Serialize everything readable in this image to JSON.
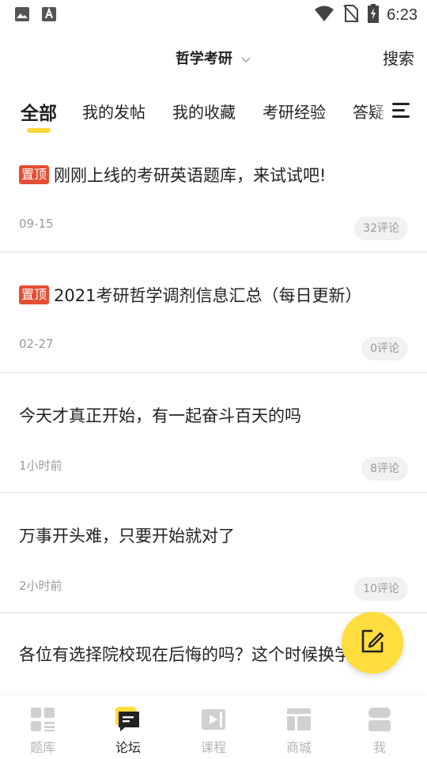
{
  "status_bar": {
    "time": "6:23",
    "icons": [
      "image-icon",
      "text-a-icon",
      "wifi-icon",
      "no-sim-icon",
      "battery-charging-icon"
    ]
  },
  "header": {
    "title": "哲学考研",
    "search_label": "搜索"
  },
  "tabs": [
    {
      "label": "全部",
      "active": true
    },
    {
      "label": "我的发帖",
      "active": false
    },
    {
      "label": "我的收藏",
      "active": false
    },
    {
      "label": "考研经验",
      "active": false
    },
    {
      "label": "答疑",
      "active": false
    }
  ],
  "posts": [
    {
      "pinned": true,
      "pin_label": "置顶",
      "title": "刚刚上线的考研英语题库，来试试吧!",
      "date": "09-15",
      "comments": "32评论"
    },
    {
      "pinned": true,
      "pin_label": "置顶",
      "title": "2021考研哲学调剂信息汇总（每日更新）",
      "date": "02-27",
      "comments": "0评论"
    },
    {
      "pinned": false,
      "title": "今天才真正开始，有一起奋斗百天的吗",
      "date": "1小时前",
      "comments": "8评论"
    },
    {
      "pinned": false,
      "title": "万事开头难，只要开始就对了",
      "date": "2小时前",
      "comments": "10评论"
    },
    {
      "pinned": false,
      "title": "各位有选择院校现在后悔的吗？这个时候换学校吗?"
    }
  ],
  "bottom_nav": [
    {
      "label": "题库",
      "icon": "grid-icon",
      "active": false
    },
    {
      "label": "论坛",
      "icon": "forum-icon",
      "active": true
    },
    {
      "label": "课程",
      "icon": "video-icon",
      "active": false
    },
    {
      "label": "商城",
      "icon": "store-icon",
      "active": false
    },
    {
      "label": "我",
      "icon": "profile-icon",
      "active": false
    }
  ],
  "colors": {
    "accent": "#FFDD3C",
    "pin_badge": "#E44E33",
    "muted_text": "#9a9a9a"
  }
}
